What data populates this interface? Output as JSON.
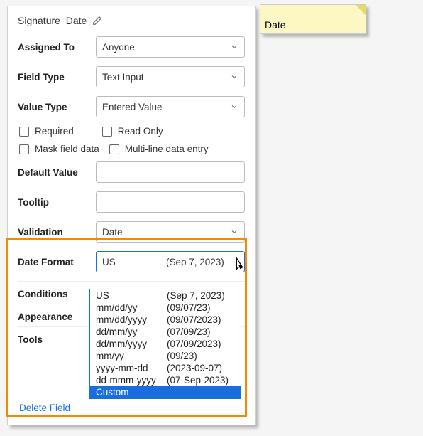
{
  "field_name": "Signature_Date",
  "preview_label": "Date",
  "labels": {
    "assigned_to": "Assigned To",
    "field_type": "Field Type",
    "value_type": "Value Type",
    "required": "Required",
    "read_only": "Read Only",
    "mask": "Mask field data",
    "multiline": "Multi-line data entry",
    "default_value": "Default Value",
    "tooltip": "Tooltip",
    "validation": "Validation",
    "date_format": "Date Format",
    "conditions": "Conditions",
    "appearance": "Appearance",
    "tools": "Tools",
    "delete": "Delete Field"
  },
  "values": {
    "assigned_to": "Anyone",
    "field_type": "Text Input",
    "value_type": "Entered Value",
    "validation": "Date",
    "date_format_display_fmt": "US",
    "date_format_display_ex": "(Sep 7, 2023)"
  },
  "date_format_options": [
    {
      "fmt": "US",
      "ex": "(Sep 7, 2023)"
    },
    {
      "fmt": "mm/dd/yy",
      "ex": "(09/07/23)"
    },
    {
      "fmt": "mm/dd/yyyy",
      "ex": "(09/07/2023)"
    },
    {
      "fmt": "dd/mm/yy",
      "ex": "(07/09/23)"
    },
    {
      "fmt": "dd/mm/yyyy",
      "ex": "(07/09/2023)"
    },
    {
      "fmt": "mm/yy",
      "ex": "(09/23)"
    },
    {
      "fmt": "yyyy-mm-dd",
      "ex": "(2023-09-07)"
    },
    {
      "fmt": "dd-mmm-yyyy",
      "ex": "(07-Sep-2023)"
    },
    {
      "fmt": "Custom",
      "ex": ""
    }
  ],
  "selected_option_index": 8
}
